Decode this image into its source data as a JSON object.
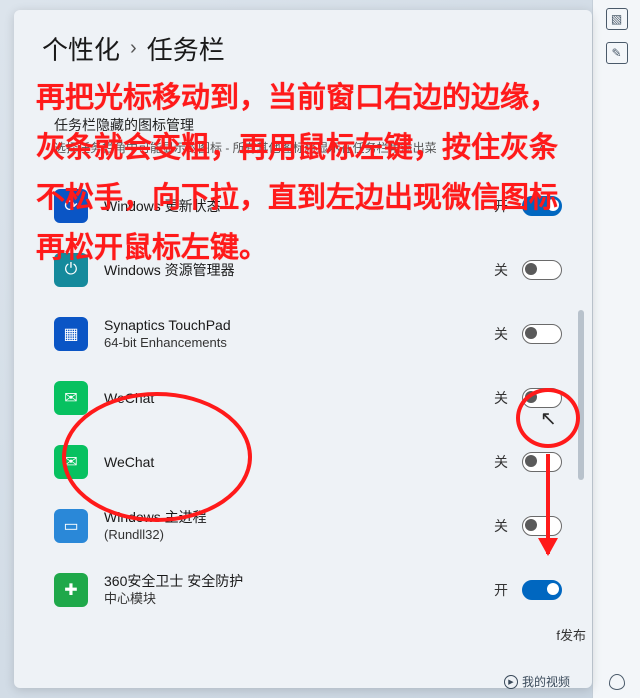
{
  "breadcrumb": {
    "parent": "个性化",
    "current": "任务栏"
  },
  "section": {
    "title": "任务栏隐藏的图标管理",
    "subtitle": "选择任务栏角中可能显示的图标 - 所有其他图标将显示在任务栏角溢出菜"
  },
  "state_labels": {
    "on": "开",
    "off": "关"
  },
  "rows": [
    {
      "icon": "windows-update-icon",
      "icon_class": "ic-blue",
      "label": "Windows 更新状态",
      "sub": "",
      "state": "on",
      "state_text": "开"
    },
    {
      "icon": "power-icon",
      "icon_class": "ic-teal",
      "label": "Windows 资源管理器",
      "sub": "",
      "state": "off",
      "state_text": "关"
    },
    {
      "icon": "touchpad-icon",
      "icon_class": "ic-blue",
      "label": "Synaptics TouchPad",
      "sub": "64-bit Enhancements",
      "state": "off",
      "state_text": "关"
    },
    {
      "icon": "wechat-icon",
      "icon_class": "ic-green",
      "label": "WeChat",
      "sub": "",
      "state": "off",
      "state_text": "关"
    },
    {
      "icon": "wechat-icon",
      "icon_class": "ic-green",
      "label": "WeChat",
      "sub": "",
      "state": "off",
      "state_text": "关"
    },
    {
      "icon": "rundll-icon",
      "icon_class": "ic-lblue",
      "label": "Windows 主进程",
      "sub": "(Rundll32)",
      "state": "off",
      "state_text": "关"
    },
    {
      "icon": "360-icon",
      "icon_class": "ic-360",
      "label": "360安全卫士 安全防护",
      "sub": "中心模块",
      "state": "on",
      "state_text": "开"
    }
  ],
  "overlay_instruction": "再把光标移动到，当前窗口右边的边缘，灰条就会变粗，再用鼠标左键，按住灰条不松手，向下拉，直到左边出现微信图标再松开鼠标左键。",
  "underlay": {
    "publish": "f发布",
    "video": "我的视频"
  },
  "colors": {
    "accent": "#0067c0",
    "annotation": "#ff1a1a"
  }
}
